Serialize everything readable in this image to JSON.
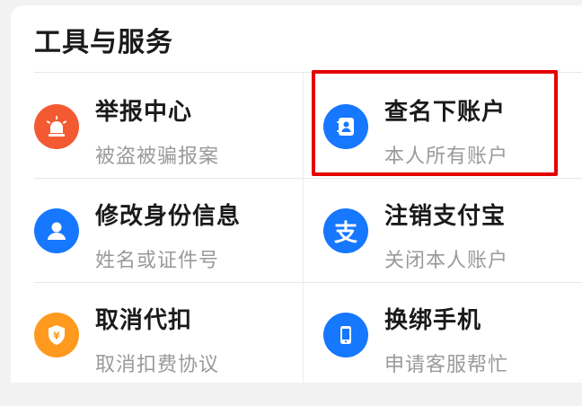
{
  "section": {
    "title": "工具与服务"
  },
  "items": [
    {
      "title": "举报中心",
      "subtitle": "被盗被骗报案",
      "icon": "alarm-siren-icon",
      "color": "#f35a32"
    },
    {
      "title": "查名下账户",
      "subtitle": "本人所有账户",
      "icon": "contacts-book-icon",
      "color": "#1677ff"
    },
    {
      "title": "修改身份信息",
      "subtitle": "姓名或证件号",
      "icon": "user-icon",
      "color": "#1677ff"
    },
    {
      "title": "注销支付宝",
      "subtitle": "关闭本人账户",
      "icon": "alipay-logo-icon",
      "color": "#1677ff",
      "glyph": "支"
    },
    {
      "title": "取消代扣",
      "subtitle": "取消扣费协议",
      "icon": "shield-yen-icon",
      "color": "#ff9a1f",
      "glyph": "¥"
    },
    {
      "title": "换绑手机",
      "subtitle": "申请客服帮忙",
      "icon": "mobile-phone-icon",
      "color": "#1677ff"
    }
  ]
}
